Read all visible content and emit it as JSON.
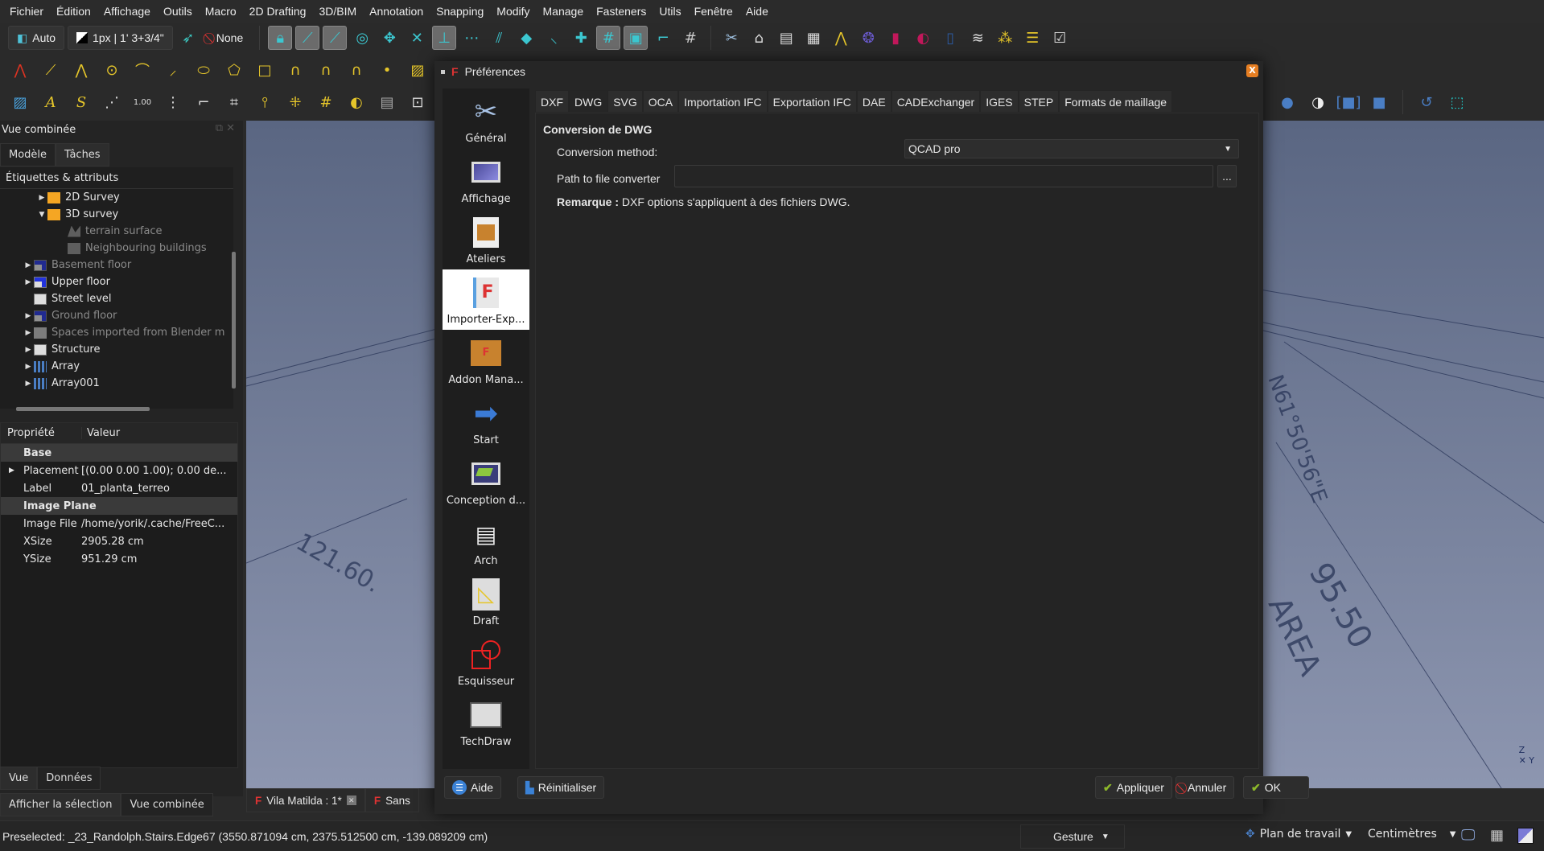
{
  "menubar": [
    "Fichier",
    "Édition",
    "Affichage",
    "Outils",
    "Macro",
    "2D Drafting",
    "3D/BIM",
    "Annotation",
    "Snapping",
    "Modify",
    "Manage",
    "Fasteners",
    "Utils",
    "Fenêtre",
    "Aide"
  ],
  "toolbar": {
    "draw_style": "Auto",
    "line_width": "1px | 1' 3+3/4\"",
    "construction": "None"
  },
  "left_panel": {
    "title": "Vue combinée",
    "tabs": [
      "Modèle",
      "Tâches"
    ],
    "tree_header": "Étiquettes & attributs",
    "tree": [
      {
        "label": "2D Survey",
        "level": 2,
        "arrow": "▶",
        "icon": "folder",
        "dim": false
      },
      {
        "label": "3D survey",
        "level": 2,
        "arrow": "▼",
        "icon": "folder",
        "dim": false
      },
      {
        "label": "terrain surface",
        "level": 3,
        "arrow": "",
        "icon": "mesh",
        "dim": true
      },
      {
        "label": "Neighbouring buildings",
        "level": 3,
        "arrow": "",
        "icon": "box",
        "dim": true
      },
      {
        "label": "Basement floor",
        "level": 1,
        "arrow": "▶",
        "icon": "level",
        "dim": true
      },
      {
        "label": "Upper floor",
        "level": 1,
        "arrow": "▶",
        "icon": "level",
        "dim": false
      },
      {
        "label": "Street level",
        "level": 1,
        "arrow": "",
        "icon": "level2",
        "dim": false
      },
      {
        "label": "Ground floor",
        "level": 1,
        "arrow": "▶",
        "icon": "level",
        "dim": true
      },
      {
        "label": "Spaces imported from Blender m",
        "level": 1,
        "arrow": "▶",
        "icon": "greyfolder",
        "dim": true
      },
      {
        "label": "Structure",
        "level": 1,
        "arrow": "▶",
        "icon": "level2",
        "dim": false
      },
      {
        "label": "Array",
        "level": 1,
        "arrow": "▶",
        "icon": "array",
        "dim": false
      },
      {
        "label": "Array001",
        "level": 1,
        "arrow": "▶",
        "icon": "array",
        "dim": false
      }
    ],
    "props_headers": [
      "Propriété",
      "Valeur"
    ],
    "props": [
      {
        "group": "Base"
      },
      {
        "key": "Placement",
        "value": "[(0.00 0.00 1.00); 0.00 de...",
        "arrow": "▶"
      },
      {
        "key": "Label",
        "value": "01_planta_terreo"
      },
      {
        "group": "Image Plane"
      },
      {
        "key": "Image File",
        "value": "/home/yorik/.cache/FreeC..."
      },
      {
        "key": "XSize",
        "value": "2905.28 cm"
      },
      {
        "key": "YSize",
        "value": "951.29 cm"
      }
    ],
    "bottom_tabs": [
      "Vue",
      "Données"
    ],
    "bottom_tabs2": [
      "Afficher la sélection",
      "Vue combinée"
    ]
  },
  "doc_tabs": [
    {
      "label": "Vila Matilda : 1*",
      "closable": true
    },
    {
      "label": "Sans",
      "closable": false
    }
  ],
  "dialog": {
    "title": "Préférences",
    "pages": [
      "Général",
      "Affichage",
      "Ateliers",
      "Importer-Exp...",
      "Addon Mana...",
      "Start",
      "Conception d...",
      "Arch",
      "Draft",
      "Esquisseur",
      "TechDraw"
    ],
    "selected_page": "Importer-Exp...",
    "tabs": [
      "DXF",
      "DWG",
      "SVG",
      "OCA",
      "Importation IFC",
      "Exportation IFC",
      "DAE",
      "CADExchanger",
      "IGES",
      "STEP",
      "Formats de maillage"
    ],
    "active_tab": "DWG",
    "section_title": "Conversion de DWG",
    "conversion_method_label": "Conversion method:",
    "conversion_method_value": "QCAD pro",
    "path_label": "Path to file converter",
    "path_value": "",
    "browse_label": "...",
    "note_bold": "Remarque :",
    "note_text": " DXF options s'appliquent à des fichiers DWG.",
    "buttons": {
      "help": "Aide",
      "reset": "Réinitialiser",
      "apply": "Appliquer",
      "cancel": "Annuler",
      "ok": "OK"
    }
  },
  "statusbar": {
    "preselected": "Preselected: _23_Randolph.Stairs.Edge67 (3550.871094 cm, 2375.512500 cm, -139.089209 cm)",
    "nav_style": "Gesture",
    "workplane": "Plan de travail",
    "units": "Centimètres"
  }
}
